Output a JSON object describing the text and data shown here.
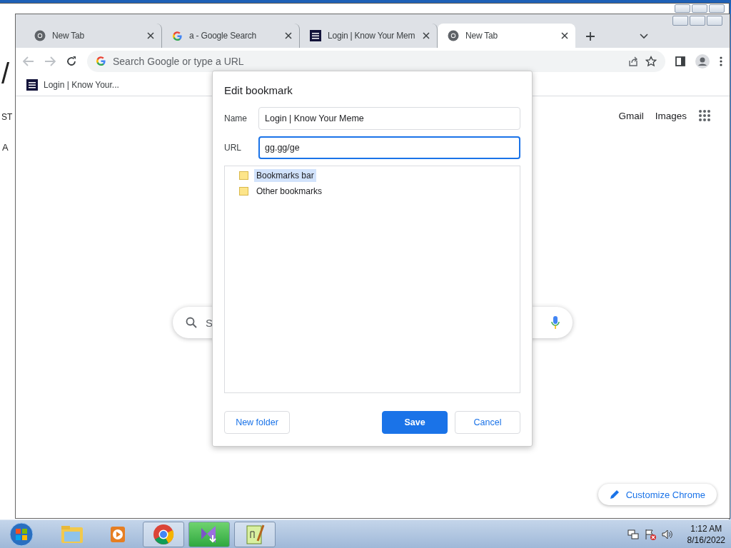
{
  "back_window": {
    "fragments": [
      "/",
      "ST",
      "A"
    ]
  },
  "browser": {
    "tabs": [
      {
        "kind": "chrome",
        "title": "New Tab",
        "selected": false
      },
      {
        "kind": "google",
        "title": "a - Google Search",
        "selected": false
      },
      {
        "kind": "meme",
        "title": "Login | Know Your Mem",
        "selected": false
      },
      {
        "kind": "chrome",
        "title": "New Tab",
        "selected": true
      }
    ],
    "omnibox": {
      "placeholder": "Search Google or type a URL"
    },
    "bookmarks": [
      {
        "title": "Login | Know Your..."
      }
    ],
    "ntp": {
      "links": [
        "Gmail",
        "Images"
      ],
      "search_fragment": "S",
      "customize": "Customize Chrome"
    }
  },
  "dialog": {
    "title": "Edit bookmark",
    "fields": [
      {
        "label": "Name",
        "value": "Login | Know Your Meme",
        "focused": false
      },
      {
        "label": "URL",
        "value": "gg.gg/ge",
        "focused": true
      }
    ],
    "folders": [
      {
        "label": "Bookmarks bar",
        "selected": true
      },
      {
        "label": "Other bookmarks",
        "selected": false
      }
    ],
    "buttons": [
      {
        "kind": "secondary",
        "label": "New folder"
      },
      {
        "kind": "primary",
        "label": "Save"
      },
      {
        "kind": "secondary",
        "label": "Cancel"
      }
    ]
  },
  "taskbar": {
    "items": [
      {
        "kind": "explorer",
        "open": false,
        "highlighted": false
      },
      {
        "kind": "media",
        "open": false,
        "highlighted": false
      },
      {
        "kind": "chrome",
        "open": true,
        "highlighted": false
      },
      {
        "kind": "installer",
        "open": true,
        "highlighted": true
      },
      {
        "kind": "notepad",
        "open": true,
        "highlighted": false
      }
    ],
    "time": "1:12 AM",
    "date": "8/16/2022"
  }
}
